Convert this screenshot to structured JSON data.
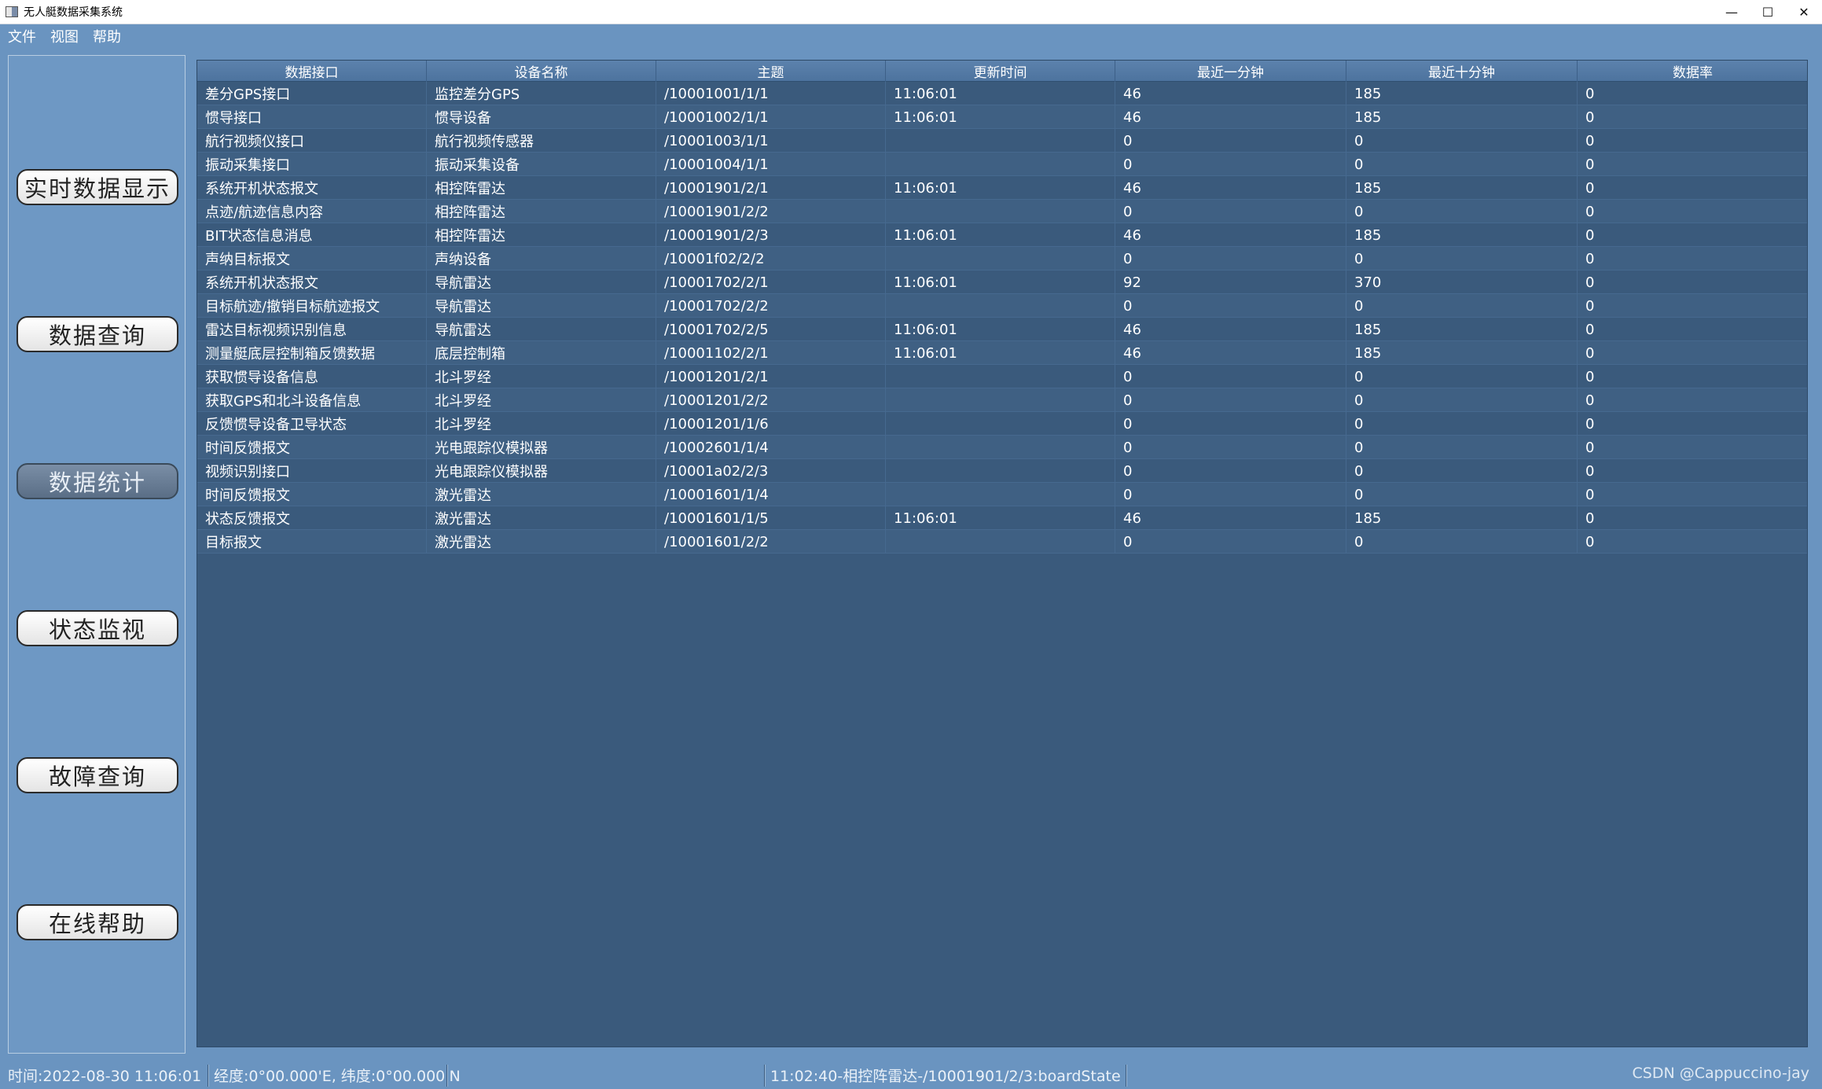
{
  "window": {
    "title": "无人艇数据采集系统"
  },
  "menu": [
    "文件",
    "视图",
    "帮助"
  ],
  "sidebar": {
    "buttons": [
      {
        "label": "实时数据显示",
        "active": false
      },
      {
        "label": "数据查询",
        "active": false
      },
      {
        "label": "数据统计",
        "active": true
      },
      {
        "label": "状态监视",
        "active": false
      },
      {
        "label": "故障查询",
        "active": false
      },
      {
        "label": "在线帮助",
        "active": false
      }
    ]
  },
  "table": {
    "columns": [
      "数据接口",
      "设备名称",
      "主题",
      "更新时间",
      "最近一分钟",
      "最近十分钟",
      "数据率"
    ],
    "rows": [
      [
        "差分GPS接口",
        "监控差分GPS",
        "/10001001/1/1",
        "11:06:01",
        "46",
        "185",
        "0"
      ],
      [
        "惯导接口",
        "惯导设备",
        "/10001002/1/1",
        "11:06:01",
        "46",
        "185",
        "0"
      ],
      [
        "航行视频仪接口",
        "航行视频传感器",
        "/10001003/1/1",
        "",
        "0",
        "0",
        "0"
      ],
      [
        "振动采集接口",
        "振动采集设备",
        "/10001004/1/1",
        "",
        "0",
        "0",
        "0"
      ],
      [
        "系统开机状态报文",
        "相控阵雷达",
        "/10001901/2/1",
        "11:06:01",
        "46",
        "185",
        "0"
      ],
      [
        "点迹/航迹信息内容",
        "相控阵雷达",
        "/10001901/2/2",
        "",
        "0",
        "0",
        "0"
      ],
      [
        "BIT状态信息消息",
        "相控阵雷达",
        "/10001901/2/3",
        "11:06:01",
        "46",
        "185",
        "0"
      ],
      [
        "声纳目标报文",
        "声纳设备",
        "/10001f02/2/2",
        "",
        "0",
        "0",
        "0"
      ],
      [
        "系统开机状态报文",
        "导航雷达",
        "/10001702/2/1",
        "11:06:01",
        "92",
        "370",
        "0"
      ],
      [
        "目标航迹/撤销目标航迹报文",
        "导航雷达",
        "/10001702/2/2",
        "",
        "0",
        "0",
        "0"
      ],
      [
        "雷达目标视频识别信息",
        "导航雷达",
        "/10001702/2/5",
        "11:06:01",
        "46",
        "185",
        "0"
      ],
      [
        "测量艇底层控制箱反馈数据",
        "底层控制箱",
        "/10001102/2/1",
        "11:06:01",
        "46",
        "185",
        "0"
      ],
      [
        "获取惯导设备信息",
        "北斗罗经",
        "/10001201/2/1",
        "",
        "0",
        "0",
        "0"
      ],
      [
        "获取GPS和北斗设备信息",
        "北斗罗经",
        "/10001201/2/2",
        "",
        "0",
        "0",
        "0"
      ],
      [
        "反馈惯导设备卫导状态",
        "北斗罗经",
        "/10001201/1/6",
        "",
        "0",
        "0",
        "0"
      ],
      [
        "时间反馈报文",
        "光电跟踪仪模拟器",
        "/10002601/1/4",
        "",
        "0",
        "0",
        "0"
      ],
      [
        "视频识别接口",
        "光电跟踪仪模拟器",
        "/10001a02/2/3",
        "",
        "0",
        "0",
        "0"
      ],
      [
        "时间反馈报文",
        "激光雷达",
        "/10001601/1/4",
        "",
        "0",
        "0",
        "0"
      ],
      [
        "状态反馈报文",
        "激光雷达",
        "/10001601/1/5",
        "11:06:01",
        "46",
        "185",
        "0"
      ],
      [
        "目标报文",
        "激光雷达",
        "/10001601/2/2",
        "",
        "0",
        "0",
        "0"
      ]
    ]
  },
  "statusbar": {
    "time": "时间:2022-08-30 11:06:01",
    "position": "经度:0°00.000'E, 纬度:0°00.000'N",
    "message": "11:02:40-相控阵雷达-/10001901/2/3:boardState",
    "watermark": "CSDN @Cappuccino-jay"
  },
  "colors": {
    "background": "#6a94c0",
    "table_bg": "#3a5a7c",
    "header_bg": "#5c82ad",
    "active_button": "#6b7f97"
  }
}
